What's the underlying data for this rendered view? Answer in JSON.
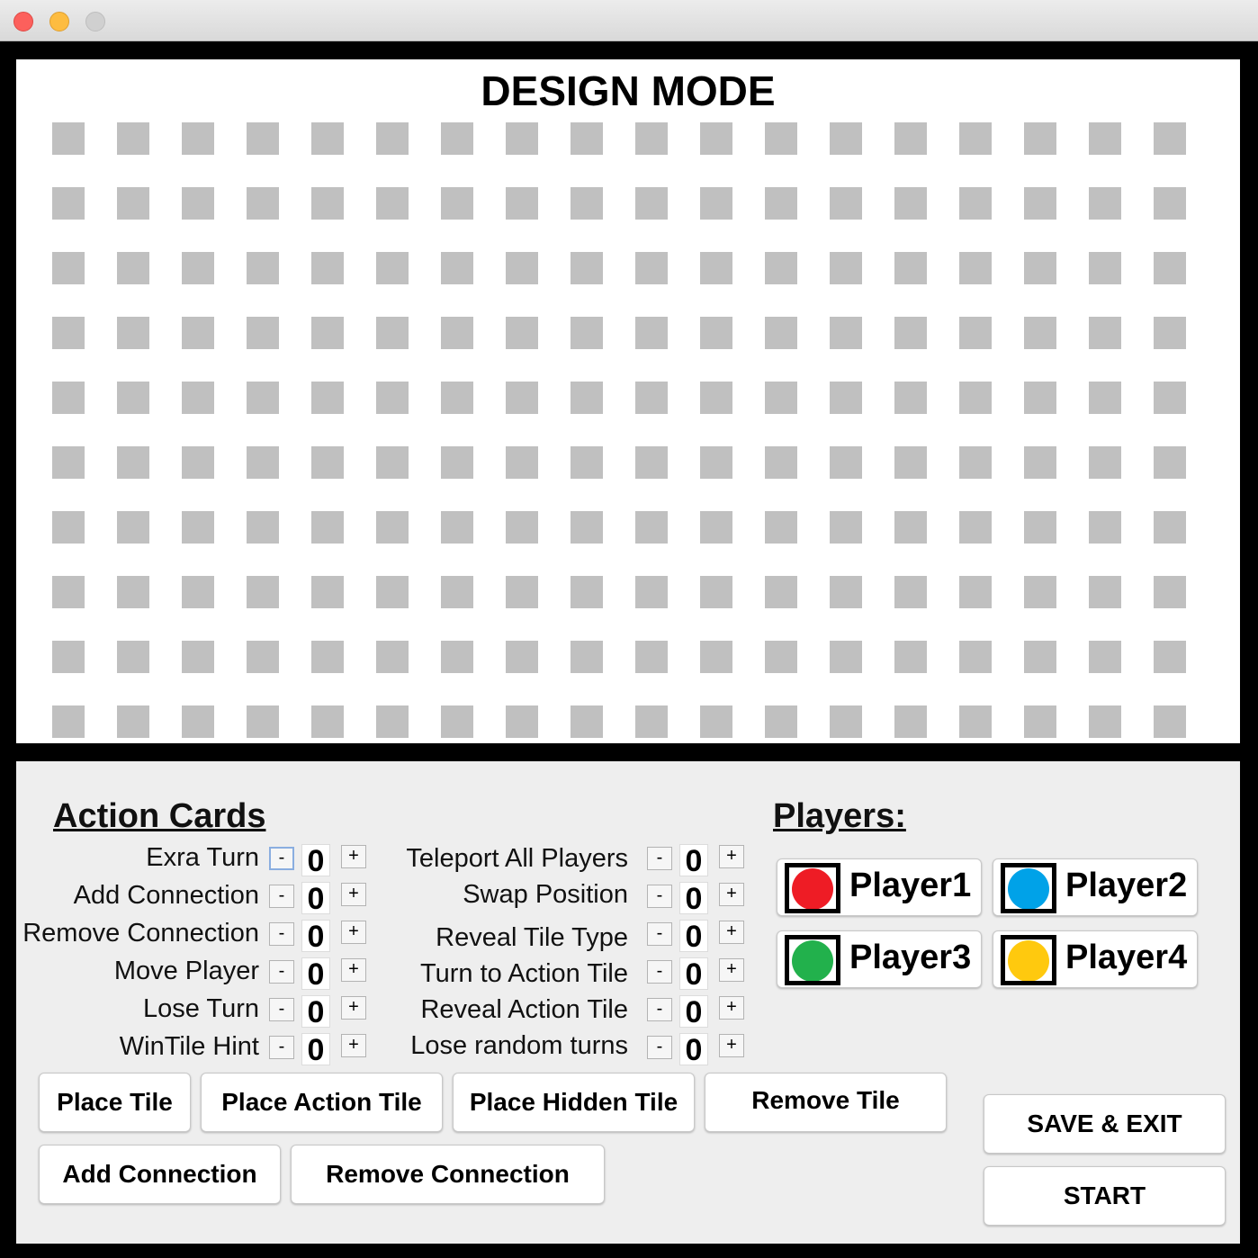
{
  "board": {
    "title": "DESIGN MODE",
    "rows": 10,
    "cols": 18
  },
  "action_cards": {
    "title": "Action Cards",
    "left": [
      {
        "label": "Exra Turn",
        "value": "0"
      },
      {
        "label": "Add Connection",
        "value": "0"
      },
      {
        "label": "Remove Connection",
        "value": "0"
      },
      {
        "label": "Move Player",
        "value": "0"
      },
      {
        "label": "Lose Turn",
        "value": "0"
      },
      {
        "label": "WinTile Hint",
        "value": "0"
      }
    ],
    "right": [
      {
        "label": "Teleport All Players",
        "value": "0"
      },
      {
        "label": "Swap Position",
        "value": "0"
      },
      {
        "label": "Reveal Tile Type",
        "value": "0"
      },
      {
        "label": "Turn to Action Tile",
        "value": "0"
      },
      {
        "label": "Reveal Action Tile",
        "value": "0"
      },
      {
        "label": "Lose random turns",
        "value": "0"
      }
    ],
    "minus": "-",
    "plus": "+"
  },
  "players": {
    "title": "Players:",
    "list": [
      {
        "name": "Player1",
        "color": "#ee1c25"
      },
      {
        "name": "Player2",
        "color": "#00a2e8"
      },
      {
        "name": "Player3",
        "color": "#22b14c"
      },
      {
        "name": "Player4",
        "color": "#ffc90e"
      }
    ]
  },
  "buttons": {
    "place_tile": "Place Tile",
    "place_action_tile": "Place Action Tile",
    "place_hidden_tile": "Place Hidden Tile",
    "remove_tile": "Remove Tile",
    "add_connection": "Add Connection",
    "remove_connection": "Remove Connection",
    "save_exit": "SAVE & EXIT",
    "start": "START"
  }
}
